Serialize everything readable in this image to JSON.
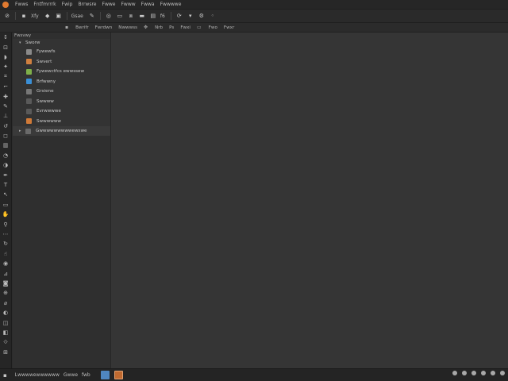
{
  "menubar": {
    "items": [
      "Fwws",
      "Fntfmrrrk",
      "Fwip",
      "Brrwsre",
      "Fwwe",
      "Fwww",
      "Fwwa",
      "Fwwwwe"
    ]
  },
  "toolbar": {
    "label_1": "Xfy",
    "label_2": "Gsae",
    "label_3": "f6"
  },
  "options_bar": {
    "items": [
      "Bwrifr",
      "Fwrdwn",
      "Nwwwss",
      "Nrb",
      "Ps",
      "Fwxi",
      "Fwo",
      "Fwxr",
      "Fwx"
    ]
  },
  "side_panel": {
    "title": "Fwsvwy",
    "root_label": "Sworw",
    "layers": [
      {
        "label": "Fywewfs",
        "color": "#8a8a8a"
      },
      {
        "label": "Swvert",
        "color": "#d08040"
      },
      {
        "label": "Fywewctfcs ewwssew",
        "color": "#7fb04a"
      },
      {
        "label": "Brfwwny",
        "color": "#3a8fd6"
      },
      {
        "label": "Grsiene",
        "color": "#777777"
      },
      {
        "label": "Swwww",
        "color": "#5a5a5a"
      },
      {
        "label": "Evrwwwwe",
        "color": "#5a5a5a"
      },
      {
        "label": "Swwwwww",
        "color": "#d07a38"
      }
    ],
    "last_row": "Gwwwwwwwwwewswe"
  },
  "statusbar": {
    "text_1": "Lwwwwewwwwww",
    "text_2": "Gwwe",
    "text_3": "fwb"
  }
}
